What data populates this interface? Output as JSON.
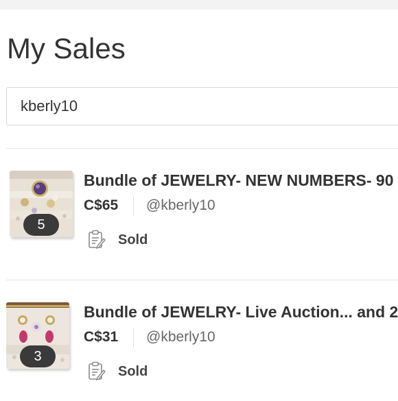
{
  "page": {
    "title": "My Sales"
  },
  "search": {
    "value": "kberly10"
  },
  "listings": [
    {
      "title": "Bundle of JEWELRY- NEW NUMBERS- 90",
      "price": "C$65",
      "seller": "@kberly10",
      "image_count": "5",
      "status": "Sold",
      "status_icon": "sold-clipboard-icon"
    },
    {
      "title": "Bundle of JEWELRY- Live Auction... and 2",
      "price": "C$31",
      "seller": "@kberly10",
      "image_count": "3",
      "status": "Sold",
      "status_icon": "sold-clipboard-icon"
    }
  ]
}
